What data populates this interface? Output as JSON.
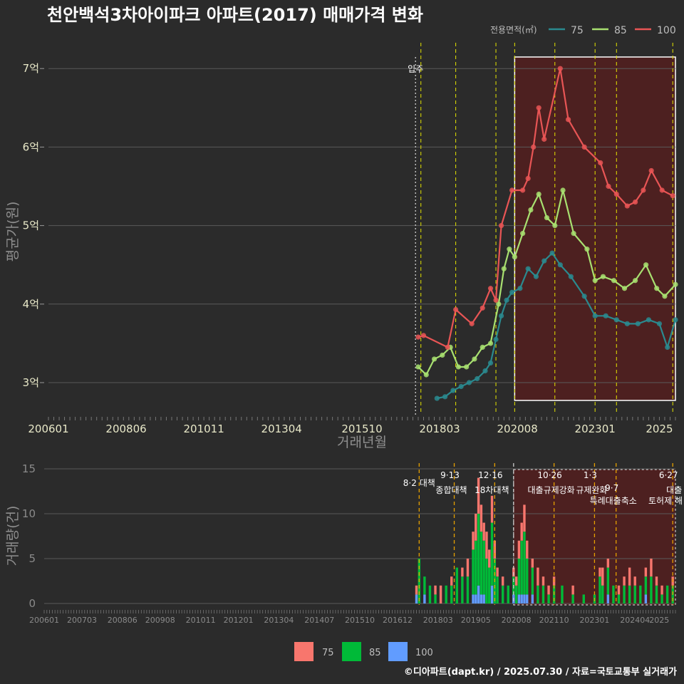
{
  "title": "천안백석3차아이파크 아파트(2017) 매매가격 변화",
  "credit": "©디아파트(dapt.kr) / 2025.07.30 / 자료=국토교통부 실거래가",
  "colors": {
    "line_75": "#2a8a8f",
    "line_85": "#a8e070",
    "line_100": "#e85555",
    "bar_75": "#f8766d",
    "bar_85": "#00ba38",
    "bar_100": "#619cff",
    "vline": "#e6e600",
    "vline_orange": "#e6a000",
    "highlight_fill": "#5a1e1e",
    "grid": "#5a5a5a"
  },
  "chart_data": [
    {
      "type": "line",
      "title": "천안백석3차아이파크 아파트(2017) 매매가격 변화",
      "xlabel": "거래년월",
      "ylabel": "평균가(원)",
      "x_ticks": [
        "200601",
        "200806",
        "201011",
        "201304",
        "201510",
        "201803",
        "202008",
        "202301",
        "2025"
      ],
      "y_ticks": [
        {
          "value": 3,
          "label": "3억"
        },
        {
          "value": 4,
          "label": "4억"
        },
        {
          "value": 5,
          "label": "5억"
        },
        {
          "value": 6,
          "label": "6억"
        },
        {
          "value": 7,
          "label": "7억"
        }
      ],
      "ylim": [
        2.6,
        7.3
      ],
      "legend_title": "전용면적(㎡)",
      "legend_position": "top-right",
      "annotation_move_in": {
        "label": "입주",
        "x": "2017-06"
      },
      "highlight_range": [
        "2020-07",
        "2025-07"
      ],
      "series": [
        {
          "name": "75",
          "color": "#2a8a8f",
          "points": [
            [
              "2018-02",
              2.8
            ],
            [
              "2018-05",
              2.82
            ],
            [
              "2018-08",
              2.9
            ],
            [
              "2018-11",
              2.95
            ],
            [
              "2019-02",
              3.0
            ],
            [
              "2019-05",
              3.05
            ],
            [
              "2019-08",
              3.15
            ],
            [
              "2019-10",
              3.25
            ],
            [
              "2019-12",
              3.55
            ],
            [
              "2020-02",
              3.85
            ],
            [
              "2020-04",
              4.05
            ],
            [
              "2020-06",
              4.15
            ],
            [
              "2020-09",
              4.2
            ],
            [
              "2020-12",
              4.45
            ],
            [
              "2021-03",
              4.35
            ],
            [
              "2021-06",
              4.55
            ],
            [
              "2021-09",
              4.65
            ],
            [
              "2021-12",
              4.5
            ],
            [
              "2022-04",
              4.35
            ],
            [
              "2022-09",
              4.1
            ],
            [
              "2023-01",
              3.85
            ],
            [
              "2023-05",
              3.85
            ],
            [
              "2023-09",
              3.8
            ],
            [
              "2024-01",
              3.75
            ],
            [
              "2024-05",
              3.75
            ],
            [
              "2024-09",
              3.8
            ],
            [
              "2025-01",
              3.75
            ],
            [
              "2025-04",
              3.45
            ],
            [
              "2025-07",
              3.8
            ]
          ]
        },
        {
          "name": "85",
          "color": "#a8e070",
          "points": [
            [
              "2017-07",
              3.2
            ],
            [
              "2017-10",
              3.1
            ],
            [
              "2018-01",
              3.3
            ],
            [
              "2018-04",
              3.35
            ],
            [
              "2018-07",
              3.45
            ],
            [
              "2018-10",
              3.2
            ],
            [
              "2019-01",
              3.2
            ],
            [
              "2019-04",
              3.3
            ],
            [
              "2019-07",
              3.45
            ],
            [
              "2019-10",
              3.5
            ],
            [
              "2020-01",
              4.0
            ],
            [
              "2020-03",
              4.45
            ],
            [
              "2020-05",
              4.7
            ],
            [
              "2020-07",
              4.6
            ],
            [
              "2020-10",
              4.9
            ],
            [
              "2021-01",
              5.2
            ],
            [
              "2021-04",
              5.4
            ],
            [
              "2021-07",
              5.1
            ],
            [
              "2021-10",
              5.0
            ],
            [
              "2022-01",
              5.45
            ],
            [
              "2022-05",
              4.9
            ],
            [
              "2022-10",
              4.7
            ],
            [
              "2023-01",
              4.3
            ],
            [
              "2023-04",
              4.35
            ],
            [
              "2023-08",
              4.3
            ],
            [
              "2023-12",
              4.2
            ],
            [
              "2024-04",
              4.3
            ],
            [
              "2024-08",
              4.5
            ],
            [
              "2024-12",
              4.2
            ],
            [
              "2025-03",
              4.1
            ],
            [
              "2025-07",
              4.25
            ]
          ]
        },
        {
          "name": "100",
          "color": "#e85555",
          "points": [
            [
              "2017-07",
              3.58
            ],
            [
              "2017-09",
              3.6
            ],
            [
              "2018-06",
              3.45
            ],
            [
              "2018-09",
              3.93
            ],
            [
              "2019-03",
              3.75
            ],
            [
              "2019-07",
              3.95
            ],
            [
              "2019-10",
              4.2
            ],
            [
              "2019-12",
              4.05
            ],
            [
              "2020-02",
              5.0
            ],
            [
              "2020-06",
              5.45
            ],
            [
              "2020-10",
              5.45
            ],
            [
              "2020-12",
              5.6
            ],
            [
              "2021-02",
              6.0
            ],
            [
              "2021-04",
              6.5
            ],
            [
              "2021-06",
              6.1
            ],
            [
              "2021-12",
              7.0
            ],
            [
              "2022-03",
              6.35
            ],
            [
              "2022-09",
              6.0
            ],
            [
              "2023-03",
              5.8
            ],
            [
              "2023-06",
              5.5
            ],
            [
              "2023-09",
              5.4
            ],
            [
              "2024-01",
              5.25
            ],
            [
              "2024-04",
              5.3
            ],
            [
              "2024-07",
              5.45
            ],
            [
              "2024-10",
              5.7
            ],
            [
              "2025-02",
              5.45
            ],
            [
              "2025-06",
              5.38
            ]
          ]
        }
      ]
    },
    {
      "type": "bar",
      "xlabel": "",
      "ylabel": "거래량(건)",
      "ylim": [
        0,
        15
      ],
      "y_ticks": [
        0,
        5,
        10,
        15
      ],
      "x_ticks": [
        "200601",
        "200703",
        "200806",
        "200908",
        "201011",
        "201201",
        "201304",
        "201407",
        "201510",
        "201612",
        "201803",
        "201905",
        "202008",
        "202110",
        "202301",
        "202404",
        "2025"
      ],
      "policy_events": [
        {
          "x": "2017-08",
          "date": "",
          "label": "8·2 대책"
        },
        {
          "x": "2018-09",
          "date": "9·13",
          "label": "종합대책"
        },
        {
          "x": "2019-12",
          "date": "12·16",
          "label": "18차대책"
        },
        {
          "x": "2020-07",
          "date": "",
          "label": ""
        },
        {
          "x": "2021-10",
          "date": "10·26",
          "label": "대출규제강화"
        },
        {
          "x": "2023-01",
          "date": "1·3",
          "label": "규제완화"
        },
        {
          "x": "2023-09",
          "date": "9·7",
          "label": "특례대출축소"
        },
        {
          "x": "2025-06",
          "date": "6·27",
          "label": "대출"
        }
      ],
      "extra_labels": [
        "토허제 해"
      ],
      "legend_position": "bottom",
      "series": [
        {
          "name": "75",
          "color": "#f8766d"
        },
        {
          "name": "85",
          "color": "#00ba38"
        },
        {
          "name": "100",
          "color": "#619cff"
        }
      ],
      "monthly_volume": [
        [
          "2017-07",
          1,
          0,
          1
        ],
        [
          "2017-08",
          0,
          5,
          0
        ],
        [
          "2017-10",
          0,
          2,
          1
        ],
        [
          "2017-12",
          0,
          2,
          0
        ],
        [
          "2018-02",
          1,
          1,
          0
        ],
        [
          "2018-04",
          2,
          0,
          0
        ],
        [
          "2018-06",
          0,
          2,
          0
        ],
        [
          "2018-08",
          1,
          2,
          0
        ],
        [
          "2018-10",
          0,
          4,
          0
        ],
        [
          "2018-12",
          1,
          3,
          0
        ],
        [
          "2019-02",
          2,
          3,
          0
        ],
        [
          "2019-04",
          2,
          5,
          1
        ],
        [
          "2019-05",
          3,
          6,
          1
        ],
        [
          "2019-06",
          4,
          8,
          2
        ],
        [
          "2019-07",
          3,
          7,
          1
        ],
        [
          "2019-08",
          2,
          6,
          1
        ],
        [
          "2019-09",
          3,
          5,
          0
        ],
        [
          "2019-10",
          2,
          4,
          0
        ],
        [
          "2019-11",
          3,
          7,
          2
        ],
        [
          "2019-12",
          2,
          5,
          0
        ],
        [
          "2020-01",
          1,
          3,
          0
        ],
        [
          "2020-03",
          1,
          2,
          0
        ],
        [
          "2020-05",
          0,
          2,
          0
        ],
        [
          "2020-07",
          1,
          2,
          1
        ],
        [
          "2020-08",
          1,
          2,
          0
        ],
        [
          "2020-09",
          2,
          4,
          1
        ],
        [
          "2020-10",
          2,
          6,
          1
        ],
        [
          "2020-11",
          3,
          7,
          1
        ],
        [
          "2020-12",
          2,
          4,
          1
        ],
        [
          "2021-02",
          1,
          3,
          1
        ],
        [
          "2021-04",
          2,
          2,
          0
        ],
        [
          "2021-06",
          1,
          2,
          0
        ],
        [
          "2021-08",
          1,
          1,
          0
        ],
        [
          "2021-10",
          1,
          2,
          0
        ],
        [
          "2022-01",
          0,
          2,
          0
        ],
        [
          "2022-05",
          1,
          1,
          0
        ],
        [
          "2022-09",
          0,
          1,
          0
        ],
        [
          "2023-01",
          0,
          1,
          0
        ],
        [
          "2023-03",
          1,
          3,
          0
        ],
        [
          "2023-04",
          2,
          2,
          0
        ],
        [
          "2023-06",
          1,
          3,
          1
        ],
        [
          "2023-08",
          0,
          2,
          0
        ],
        [
          "2023-10",
          1,
          1,
          0
        ],
        [
          "2023-12",
          1,
          2,
          0
        ],
        [
          "2024-02",
          2,
          2,
          0
        ],
        [
          "2024-04",
          1,
          2,
          0
        ],
        [
          "2024-06",
          0,
          2,
          0
        ],
        [
          "2024-08",
          1,
          2,
          1
        ],
        [
          "2024-10",
          2,
          3,
          0
        ],
        [
          "2024-12",
          1,
          2,
          0
        ],
        [
          "2025-02",
          1,
          1,
          0
        ],
        [
          "2025-04",
          0,
          2,
          0
        ],
        [
          "2025-06",
          1,
          2,
          0
        ]
      ]
    }
  ]
}
